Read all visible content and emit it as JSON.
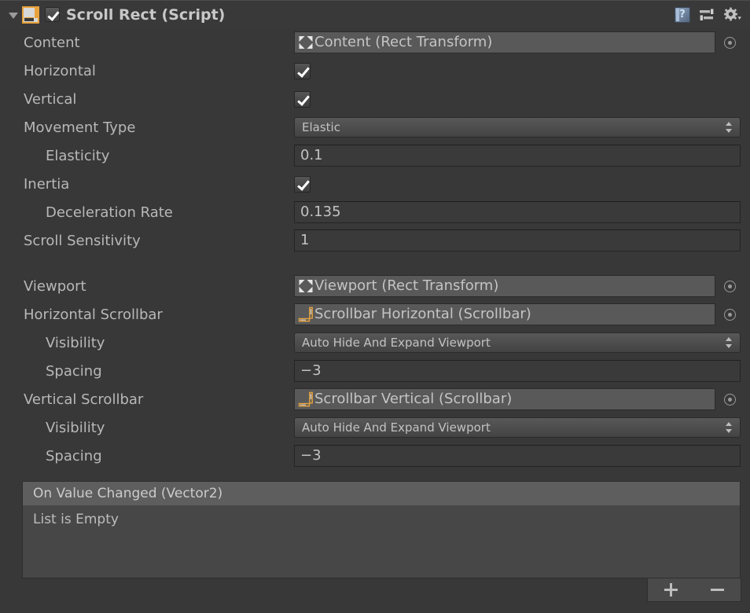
{
  "header": {
    "title": "Scroll Rect (Script)",
    "enabled": true,
    "foldout_expanded": true,
    "script_icon": "scroll-rect-script-icon",
    "icons": [
      {
        "name": "help-icon",
        "label": "?"
      },
      {
        "name": "preset-icon",
        "label": ""
      },
      {
        "name": "gear-icon",
        "label": ""
      }
    ]
  },
  "colors": {
    "background": "#383838",
    "header_bg": "#393939",
    "field_bg": "#3a3a3a",
    "object_field_bg": "#595959",
    "event_header_bg": "#5e5e5e",
    "accent_orange": "#e8a33d",
    "text": "#b8b8b8"
  },
  "properties": [
    {
      "label": "Content",
      "type": "object",
      "value": "Content (Rect Transform)",
      "icon": "rect-transform-icon",
      "indent": false
    },
    {
      "label": "Horizontal",
      "type": "checkbox",
      "value": true,
      "indent": false
    },
    {
      "label": "Vertical",
      "type": "checkbox",
      "value": true,
      "indent": false
    },
    {
      "label": "Movement Type",
      "type": "popup",
      "value": "Elastic",
      "indent": false
    },
    {
      "label": "Elasticity",
      "type": "number",
      "value": "0.1",
      "indent": true
    },
    {
      "label": "Inertia",
      "type": "checkbox",
      "value": true,
      "indent": false
    },
    {
      "label": "Deceleration Rate",
      "type": "number",
      "value": "0.135",
      "indent": true
    },
    {
      "label": "Scroll Sensitivity",
      "type": "number",
      "value": "1",
      "indent": false
    },
    {
      "label": "Viewport",
      "type": "object",
      "value": "Viewport (Rect Transform)",
      "icon": "rect-transform-icon",
      "indent": false
    },
    {
      "label": "Horizontal Scrollbar",
      "type": "object",
      "value": "Scrollbar Horizontal (Scrollbar)",
      "icon": "scrollbar-icon",
      "indent": false
    },
    {
      "label": "Visibility",
      "type": "popup",
      "value": "Auto Hide And Expand Viewport",
      "indent": true
    },
    {
      "label": "Spacing",
      "type": "number",
      "value": "−3",
      "indent": true
    },
    {
      "label": "Vertical Scrollbar",
      "type": "object",
      "value": "Scrollbar Vertical (Scrollbar)",
      "icon": "scrollbar-icon",
      "indent": false
    },
    {
      "label": "Visibility",
      "type": "popup",
      "value": "Auto Hide And Expand Viewport",
      "indent": true
    },
    {
      "label": "Spacing",
      "type": "number",
      "value": "−3",
      "indent": true
    }
  ],
  "event_list": {
    "title": "On Value Changed (Vector2)",
    "empty_text": "List is Empty",
    "add_label": "+",
    "remove_label": "−"
  }
}
